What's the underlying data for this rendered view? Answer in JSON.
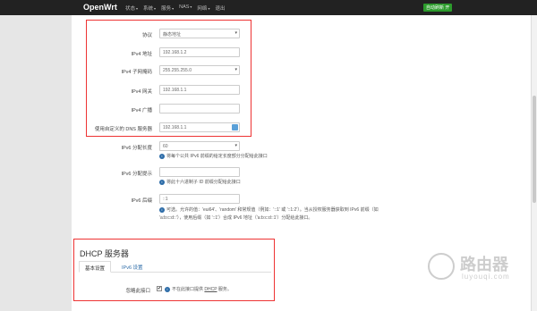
{
  "brand": "OpenWrt",
  "nav": [
    "状态",
    "系统",
    "服务",
    "NAS",
    "网络",
    "退出"
  ],
  "badge": "自动刷新 开",
  "form": {
    "protocol": {
      "label": "协议",
      "value": "静态地址"
    },
    "ipv4_addr": {
      "label": "IPv4 地址",
      "value": "192.168.1.2"
    },
    "netmask": {
      "label": "IPv4 子网掩码",
      "value": "255.255.255.0"
    },
    "gateway": {
      "label": "IPv4 网关",
      "value": "192.168.1.1"
    },
    "broadcast": {
      "label": "IPv4 广播",
      "value": ""
    },
    "dns": {
      "label": "使用自定义的 DNS 服务器",
      "value": "192.168.1.1"
    },
    "ipv6_len": {
      "label": "IPv6 分配长度",
      "value": "60",
      "hint": "将每个公共 IPv6 前缀的给定长度部分分配给此接口"
    },
    "ipv6_hint": {
      "label": "IPv6 分配提示",
      "value": "",
      "hint": "将此十六进制子 ID 前缀分配给此接口"
    },
    "ipv6_suffix": {
      "label": "IPv6 后缀",
      "value": "::1",
      "hint1": "可选。允许的值：'eui64'、'random' 和常规值（例如：'::1' 或 '::1:2'）。当从授权服务器获取到 IPv6 前缀（如",
      "hint2": "'a:b:c:d::'），使用后缀（如 '::1'）合成 IPv6 地址（'a:b:c:d::1'）分配给此接口。"
    }
  },
  "dhcp": {
    "title": "DHCP 服务器",
    "tab_basic": "基本设置",
    "tab_ipv6": "IPv6 设置",
    "ignore_label": "忽略此接口",
    "ignore_checked": "✔",
    "ignore_hint_a": "不在此接口提供",
    "ignore_hint_b": "DHCP",
    "ignore_hint_c": "服务。"
  },
  "watermark": {
    "title": "路由器",
    "sub": "luyouqi.com"
  }
}
